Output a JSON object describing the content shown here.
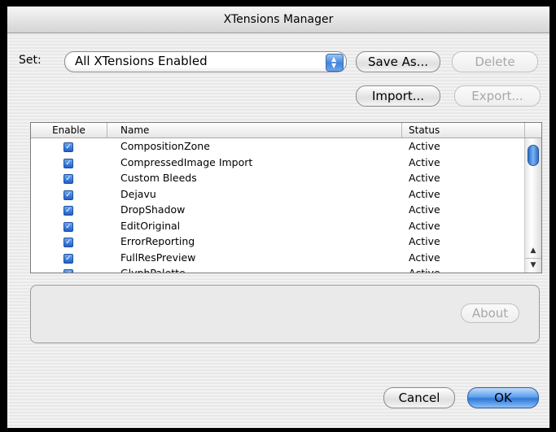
{
  "window": {
    "title": "XTensions Manager"
  },
  "set": {
    "label": "Set:",
    "selected": "All XTensions Enabled",
    "save_as": "Save As...",
    "delete": "Delete",
    "import": "Import...",
    "export": "Export..."
  },
  "table": {
    "headers": [
      "Enable",
      "Name",
      "Status"
    ],
    "rows": [
      {
        "enabled": true,
        "name": "CompositionZone",
        "status": "Active"
      },
      {
        "enabled": true,
        "name": "CompressedImage Import",
        "status": "Active"
      },
      {
        "enabled": true,
        "name": "Custom Bleeds",
        "status": "Active"
      },
      {
        "enabled": true,
        "name": "Dejavu",
        "status": "Active"
      },
      {
        "enabled": true,
        "name": "DropShadow",
        "status": "Active"
      },
      {
        "enabled": true,
        "name": "EditOriginal",
        "status": "Active"
      },
      {
        "enabled": true,
        "name": "ErrorReporting",
        "status": "Active"
      },
      {
        "enabled": true,
        "name": "FullResPreview",
        "status": "Active"
      },
      {
        "enabled": true,
        "name": "GlyphPalette",
        "status": "Active"
      }
    ]
  },
  "about": "About",
  "buttons": {
    "cancel": "Cancel",
    "ok": "OK"
  },
  "icons": {
    "checkbox": "checkmark-icon",
    "popup": "up-down-arrows-icon"
  }
}
